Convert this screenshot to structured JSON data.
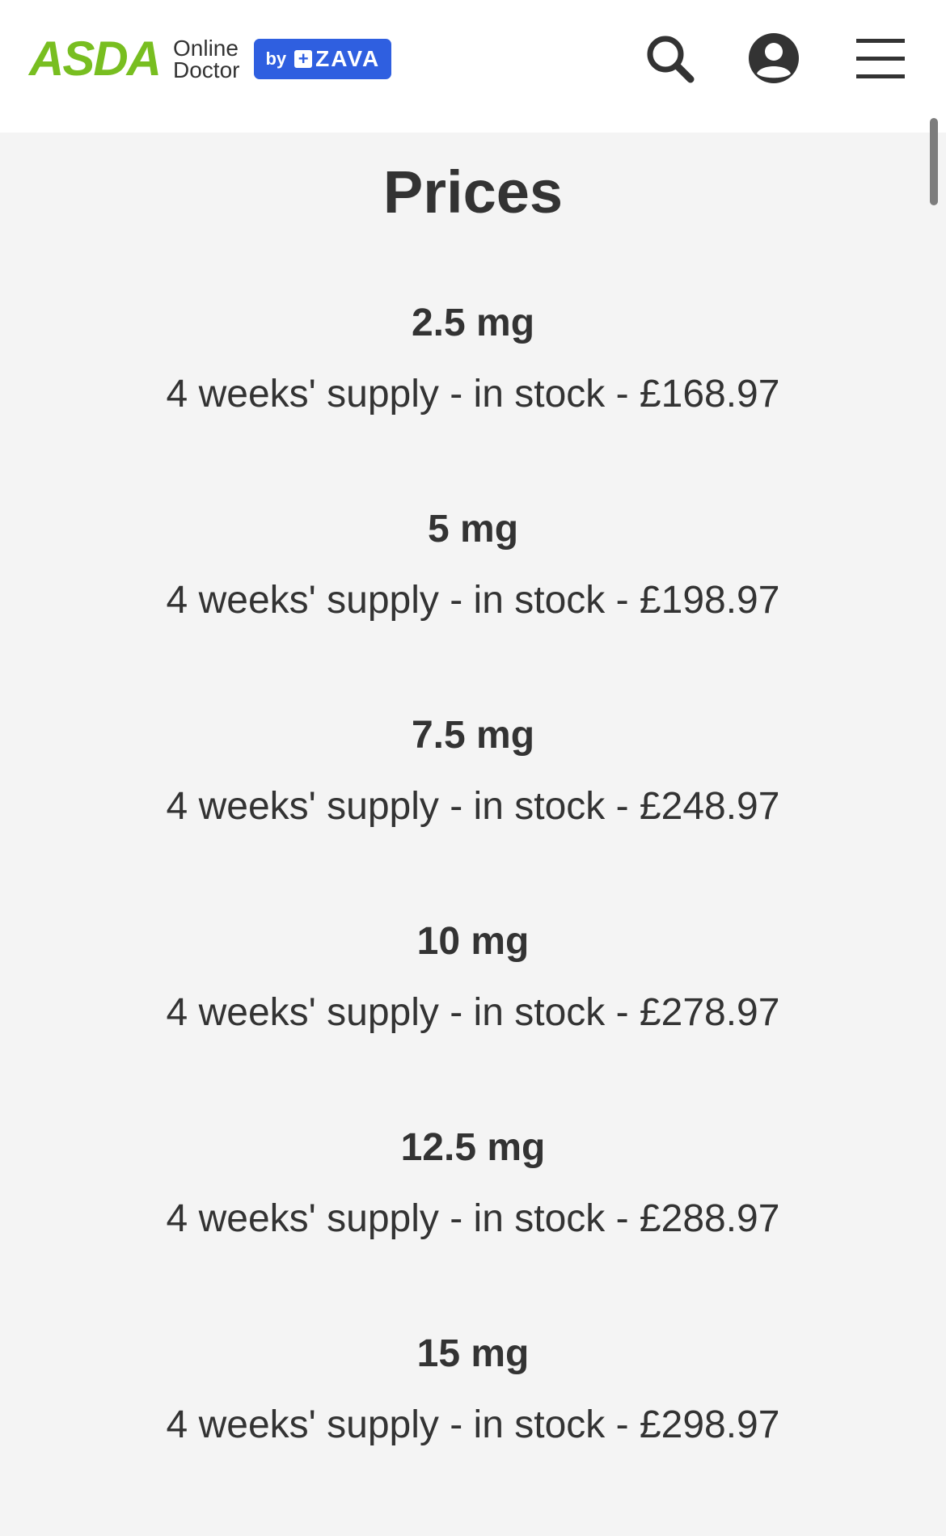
{
  "header": {
    "logo_brand": "ASDA",
    "logo_line1": "Online",
    "logo_line2": "Doctor",
    "badge_by": "by",
    "badge_name": "ZAVA",
    "icons": [
      "search-icon",
      "account-icon",
      "menu-icon"
    ]
  },
  "page": {
    "title": "Prices"
  },
  "prices": [
    {
      "dose": "2.5 mg",
      "line": "4 weeks' supply - in stock - £168.97"
    },
    {
      "dose": "5 mg",
      "line": "4 weeks' supply - in stock - £198.97"
    },
    {
      "dose": "7.5 mg",
      "line": "4 weeks' supply - in stock - £248.97"
    },
    {
      "dose": "10 mg",
      "line": "4 weeks' supply - in stock - £278.97"
    },
    {
      "dose": "12.5 mg",
      "line": "4 weeks' supply - in stock - £288.97"
    },
    {
      "dose": "15 mg",
      "line": "4 weeks' supply - in stock - £298.97"
    }
  ],
  "colors": {
    "brand_green": "#78be20",
    "zava_blue": "#2f5fe0",
    "text": "#333333",
    "background": "#f4f4f4"
  }
}
